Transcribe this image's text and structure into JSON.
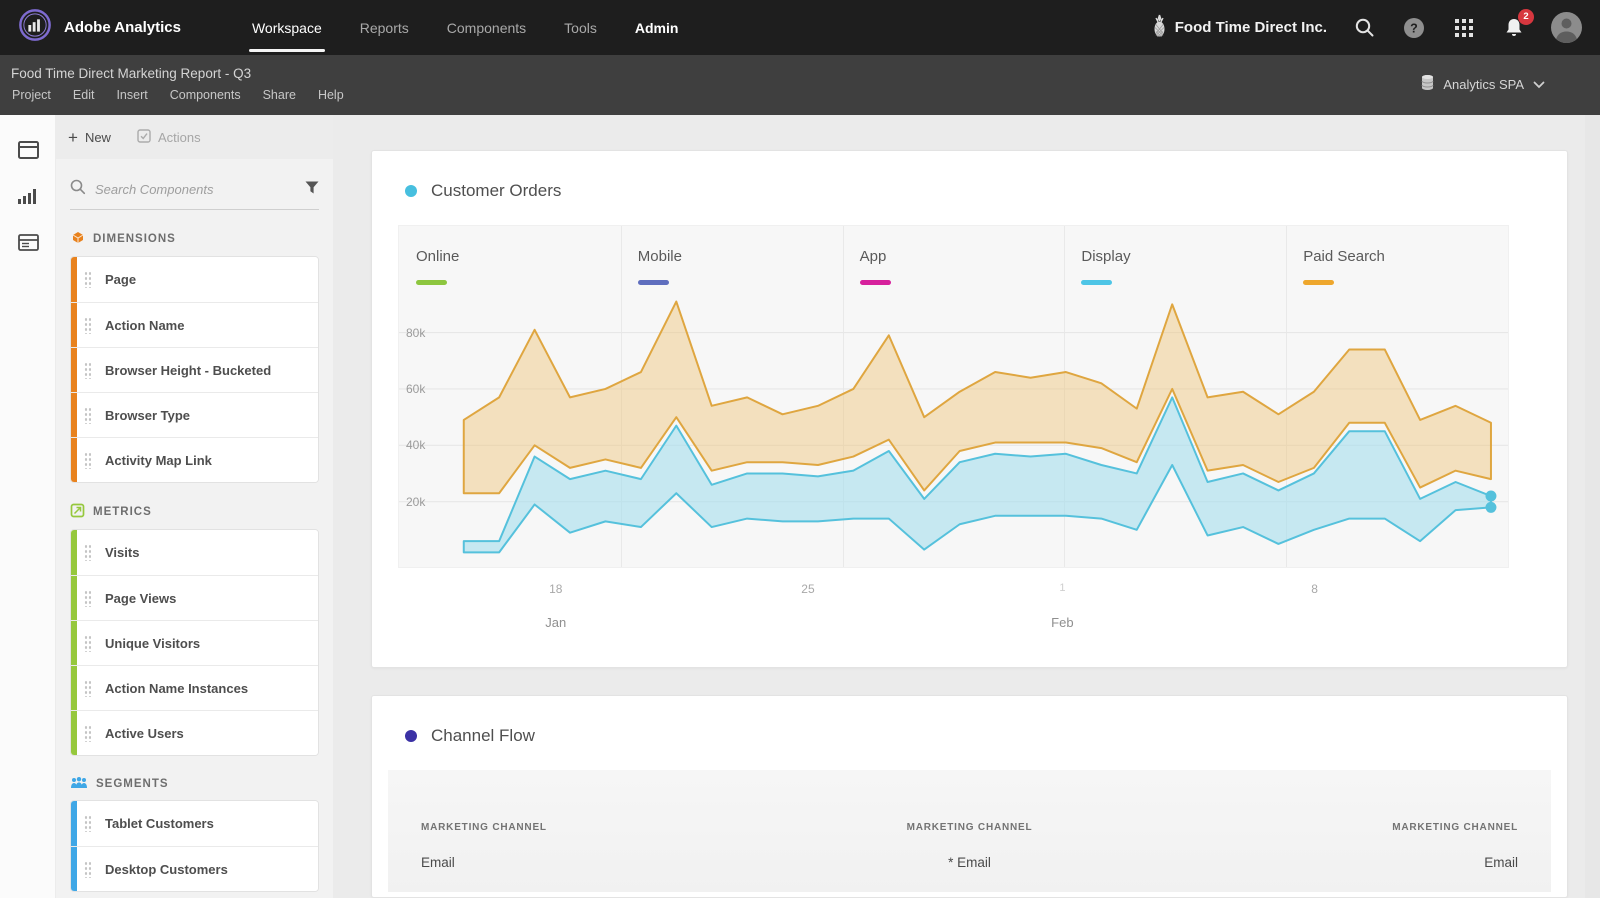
{
  "top_nav": {
    "brand": "Adobe Analytics",
    "items": [
      {
        "label": "Workspace",
        "cls": "active"
      },
      {
        "label": "Reports"
      },
      {
        "label": "Components"
      },
      {
        "label": "Tools"
      },
      {
        "label": "Admin",
        "cls": "bright"
      }
    ],
    "company": "Food Time Direct Inc.",
    "notification_count": "2",
    "icons": [
      "pineapple-icon",
      "search-icon",
      "help-icon",
      "app-grid-icon",
      "bell-icon",
      "avatar"
    ]
  },
  "project_bar": {
    "title": "Food Time Direct Marketing Report - Q3",
    "menu": [
      "Project",
      "Edit",
      "Insert",
      "Components",
      "Share",
      "Help"
    ],
    "report_suite": "Analytics SPA"
  },
  "left_rail": {
    "icons": [
      "panels-icon",
      "visualizations-icon",
      "components-table-icon"
    ]
  },
  "sidebar": {
    "new_label": "New",
    "actions_label": "Actions",
    "search_placeholder": "Search Components",
    "dimensions": {
      "title": "DIMENSIONS",
      "color": "#E8821E",
      "items": [
        "Page",
        "Action Name",
        "Browser Height - Bucketed",
        "Browser Type",
        "Activity Map Link"
      ]
    },
    "metrics": {
      "title": "METRICS",
      "color": "#96C83D",
      "items": [
        "Visits",
        "Page Views",
        "Unique Visitors",
        "Action Name Instances",
        "Active Users"
      ]
    },
    "segments": {
      "title": "SEGMENTS",
      "color": "#3FA7E6",
      "items": [
        "Tablet Customers",
        "Desktop Customers"
      ]
    }
  },
  "panels": {
    "customer_orders": {
      "title": "Customer Orders",
      "dot_color": "#47BFDF"
    },
    "channel_flow": {
      "title": "Channel Flow",
      "dot_color": "#3B31A5",
      "columns": [
        {
          "header": "MARKETING CHANNEL",
          "value": "Email"
        },
        {
          "header": "MARKETING CHANNEL",
          "value": "* Email"
        },
        {
          "header": "MARKETING CHANNEL",
          "value": "Email"
        }
      ]
    }
  },
  "chart_data": {
    "type": "area",
    "title": "Customer Orders",
    "unit": "thousands",
    "ylim": [
      0,
      118
    ],
    "grid": true,
    "segments": [
      {
        "label": "Online",
        "color": "#8DC63F"
      },
      {
        "label": "Mobile",
        "color": "#5F6EBE"
      },
      {
        "label": "App",
        "color": "#D6219C"
      },
      {
        "label": "Display",
        "color": "#4EC5E6"
      },
      {
        "label": "Paid Search",
        "color": "#EEA72D"
      }
    ],
    "x": [
      "Jan 15",
      "Jan 16",
      "Jan 17",
      "Jan 18",
      "Jan 19",
      "Jan 20",
      "Jan 21",
      "Jan 22",
      "Jan 23",
      "Jan 24",
      "Jan 25",
      "Jan 26",
      "Jan 27",
      "Jan 28",
      "Jan 29",
      "Jan 30",
      "Jan 31",
      "Feb 1",
      "Feb 2",
      "Feb 3",
      "Feb 4",
      "Feb 5",
      "Feb 6",
      "Feb 7",
      "Feb 8",
      "Feb 9",
      "Feb 10",
      "Feb 11",
      "Feb 12",
      "Feb 13"
    ],
    "x_ticks": [
      {
        "label": "18",
        "x": "14.2%"
      },
      {
        "label": "25",
        "x": "36.9%"
      },
      {
        "label": "1",
        "x": "59.8%",
        "cls": "dim"
      },
      {
        "label": "8",
        "x": "82.5%"
      }
    ],
    "month_labels": [
      {
        "label": "Jan",
        "x": "14.2%"
      },
      {
        "label": "Feb",
        "x": "59.8%"
      }
    ],
    "y_ticks": [
      {
        "label": "80k",
        "value": 80
      },
      {
        "label": "60k",
        "value": 60
      },
      {
        "label": "40k",
        "value": 40
      },
      {
        "label": "20k",
        "value": 20
      }
    ],
    "series": [
      {
        "name": "orders-band-orange",
        "line_color": "#DFA640",
        "fill_color": "#EEC170",
        "fill_opacity": 0.42,
        "upper": [
          49,
          57,
          81,
          57,
          60,
          66,
          91,
          54,
          57,
          51,
          54,
          60,
          79,
          50,
          59,
          66,
          64,
          66,
          62,
          53,
          90,
          57,
          59,
          51,
          59,
          74,
          74,
          49,
          54,
          48
        ],
        "lower": [
          23,
          23,
          40,
          32,
          35,
          32,
          50,
          31,
          34,
          34,
          33,
          36,
          42,
          24,
          38,
          41,
          41,
          41,
          39,
          34,
          60,
          31,
          33,
          27,
          32,
          48,
          48,
          25,
          31,
          28
        ]
      },
      {
        "name": "orders-band-blue",
        "line_color": "#55C1DC",
        "fill_color": "#9FDCEC",
        "fill_opacity": 0.55,
        "end_dots": true,
        "upper": [
          6,
          6,
          36,
          28,
          31,
          28,
          47,
          26,
          30,
          30,
          29,
          31,
          38,
          21,
          34,
          37,
          36,
          37,
          33,
          30,
          57,
          27,
          30,
          24,
          30,
          45,
          45,
          21,
          27,
          22
        ],
        "lower": [
          2,
          2,
          19,
          9,
          13,
          11,
          23,
          11,
          14,
          13,
          13,
          14,
          14,
          3,
          12,
          15,
          15,
          15,
          14,
          10,
          33,
          8,
          11,
          5,
          10,
          14,
          14,
          6,
          17,
          18
        ]
      }
    ]
  }
}
